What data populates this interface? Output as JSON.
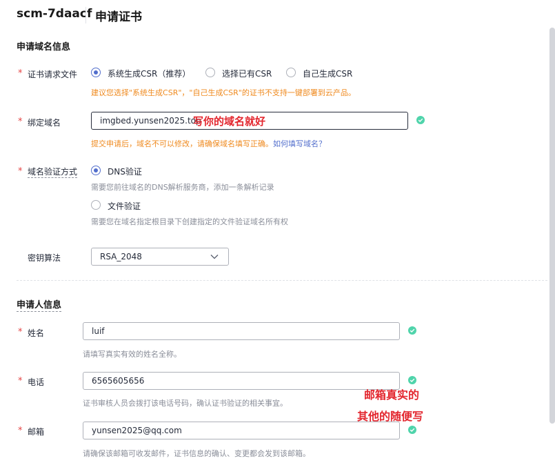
{
  "header": {
    "title": "scm-7daacf",
    "page": "申请证书"
  },
  "domain_section": {
    "title": "申请域名信息",
    "csr": {
      "label": "证书请求文件",
      "options": [
        "系统生成CSR（推荐）",
        "选择已有CSR",
        "自己生成CSR"
      ],
      "selected": 0,
      "hint": "建议您选择\"系统生成CSR\"，\"自己生成CSR\"的证书不支持一键部署到云产品。"
    },
    "bind_domain": {
      "label": "绑定域名",
      "value": "imgbed.yunsen2025.top",
      "hint": "提交申请后，域名不可以修改，请确保域名填写正确。",
      "hint_link": "如何填写域名？"
    },
    "verify": {
      "label": "域名验证方式",
      "options": [
        {
          "label": "DNS验证",
          "desc": "需要您前往域名的DNS解析服务商，添加一条解析记录"
        },
        {
          "label": "文件验证",
          "desc": "需要您在域名指定根目录下创建指定的文件验证域名所有权"
        }
      ],
      "selected": 0
    },
    "algorithm": {
      "label": "密钥算法",
      "value": "RSA_2048"
    }
  },
  "applicant_section": {
    "title": "申请人信息",
    "name": {
      "label": "姓名",
      "value": "luif",
      "hint": "请填写真实有效的姓名全称。"
    },
    "phone": {
      "label": "电话",
      "value": "6565605656",
      "hint": "证书审核人员会拨打该电话号码，确认证书验证的相关事宜。"
    },
    "email": {
      "label": "邮箱",
      "value": "yunsen2025@qq.com",
      "hint": "请确保该邮箱可收发邮件，证书信息的确认、变更都会发到该邮箱。"
    }
  },
  "annotations": {
    "domain_note": "写你的域名就好",
    "email_note_line1": "邮箱真实的",
    "email_note_line2": "其他的随便写"
  },
  "colors": {
    "accent": "#526ecc",
    "success": "#50d4ab",
    "required": "#e54545",
    "warning": "#ef8a1f",
    "annotation": "#e3262e"
  }
}
